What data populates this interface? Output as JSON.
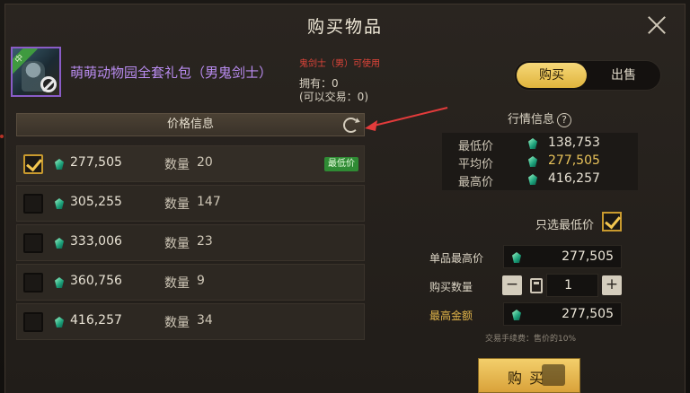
{
  "window": {
    "title": "购买物品"
  },
  "item": {
    "tag": "中",
    "name": "萌萌动物园全套礼包（男鬼剑士）",
    "class_note": "鬼剑士（男）可使用",
    "owned_line": "拥有：0",
    "tradable_line": "(可以交易：0)"
  },
  "tabs": [
    {
      "label": "购买",
      "active": true
    },
    {
      "label": "出售",
      "active": false
    }
  ],
  "price_info": {
    "header": "价格信息",
    "qty_label": "数量",
    "rows": [
      {
        "price": "277,505",
        "qty": "20",
        "checked": true,
        "badge": "最低价"
      },
      {
        "price": "305,255",
        "qty": "147",
        "checked": false,
        "badge": ""
      },
      {
        "price": "333,006",
        "qty": "23",
        "checked": false,
        "badge": ""
      },
      {
        "price": "360,756",
        "qty": "9",
        "checked": false,
        "badge": ""
      },
      {
        "price": "416,257",
        "qty": "34",
        "checked": false,
        "badge": ""
      }
    ]
  },
  "market": {
    "title": "行情信息",
    "help": "?",
    "rows": [
      {
        "label": "最低价",
        "value": "138,753"
      },
      {
        "label": "平均价",
        "value": "277,505"
      },
      {
        "label": "最高价",
        "value": "416,257"
      }
    ]
  },
  "form": {
    "lowest_only": "只选最低价",
    "lowest_only_checked": true,
    "unit_max_label": "单品最高价",
    "unit_max_value": "277,505",
    "qty_label": "购买数量",
    "qty_value": "1",
    "minus": "−",
    "plus": "+",
    "total_label": "最高金额",
    "total_value": "277,505",
    "fee_note": "交易手续费：售价的10%"
  },
  "buy_button": {
    "label": "购买"
  },
  "colors": {
    "accent_gold": "#e9c35a",
    "item_purple": "#b98cf0",
    "warning_red": "#e2453a",
    "badge_green": "#2f8b34"
  }
}
